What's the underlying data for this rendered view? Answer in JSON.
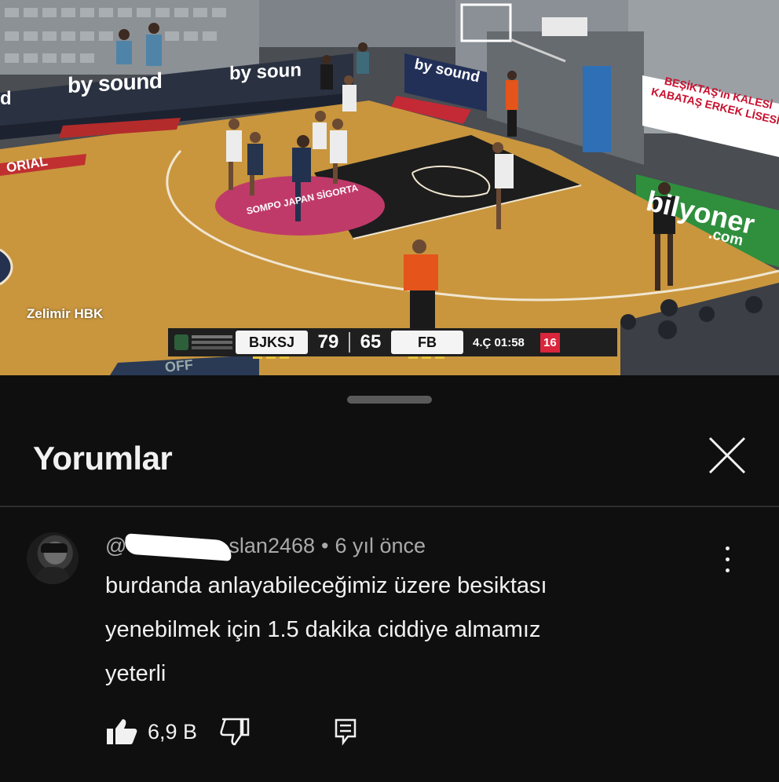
{
  "video": {
    "watermark": "Zelimir HBK",
    "ads": {
      "bysound_1": "by sound",
      "bysound_2": "by soun",
      "bysound_3": "by sound",
      "left_edge": "d",
      "besiktas_banner": "BEŞİKTAŞ'ın KALESİ KABATAŞ ERKEK LİSESİ",
      "bilyoner": "bilyoner",
      "bilyoner_com": ".com",
      "sompo": "SOMPO JAPAN SİGORTA",
      "orial": "ORIAL",
      "off": "OFF"
    },
    "scoreboard": {
      "home_team": "BJKSJ",
      "home_score": "79",
      "away_score": "65",
      "away_team": "FB",
      "period_clock": "4.Ç 01:58",
      "shot_clock": "16"
    }
  },
  "comments_panel": {
    "title": "Yorumlar",
    "comment": {
      "author_prefix": "@",
      "author_suffix": "slan2468",
      "time_ago": "6 yıl önce",
      "text_line_1": "burdanda anlayabileceğimiz üzere besiktası",
      "text_line_2": "yenebilmek için 1.5 dakika ciddiye almamız",
      "text_line_3": "yeterli",
      "like_count": "6,9 B"
    }
  },
  "icons": {
    "close": "close-icon",
    "menu": "more-vert-icon",
    "like": "thumb-up-icon",
    "dislike": "thumb-down-icon",
    "reply": "reply-icon"
  },
  "colors": {
    "panel_bg": "#0f0f0f",
    "text_primary": "#f1f1f1",
    "text_secondary": "#aaaaaa",
    "shot_clock_red": "#d9263c",
    "court_wood": "#c9963e"
  }
}
